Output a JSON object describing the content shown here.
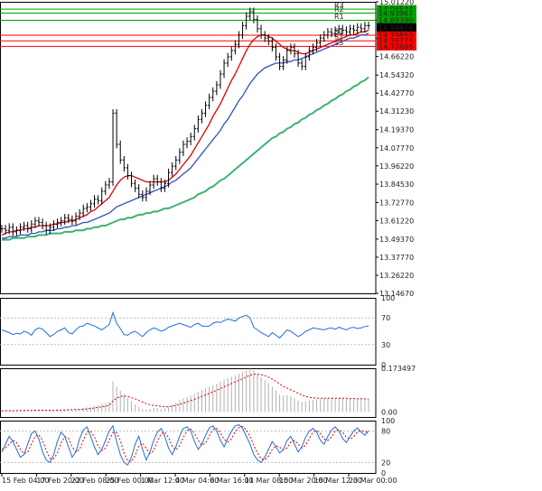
{
  "chart_data": {
    "type": "line",
    "main": {
      "y_axis_ticks": [
        "15.01220",
        "14.89510",
        "14.77700",
        "14.66220",
        "14.54320",
        "14.42770",
        "14.31230",
        "14.19370",
        "14.07770",
        "13.96220",
        "13.84530",
        "13.72770",
        "13.61220",
        "13.49370",
        "13.37770",
        "13.26220",
        "13.14670"
      ],
      "ylim": [
        13.1467,
        15.0122
      ],
      "x_tick_labels": [
        "15 Feb 04:00",
        "17 Feb 20:00",
        "22 Feb 08:00",
        "25 Feb 00:00",
        "1 Mar 12:00",
        "4 Mar 04:00",
        "8 Mar 16:00",
        "11 Mar 08:00",
        "15 Mar 20:00",
        "18 Mar 12:00",
        "23 Mar 00:00"
      ],
      "price_close": [
        13.56,
        13.55,
        13.57,
        13.54,
        13.55,
        13.57,
        13.58,
        13.56,
        13.59,
        13.61,
        13.6,
        13.58,
        13.55,
        13.57,
        13.59,
        13.6,
        13.61,
        13.63,
        13.62,
        13.61,
        13.64,
        13.66,
        13.69,
        13.7,
        13.72,
        13.75,
        13.74,
        13.8,
        13.84,
        13.86,
        14.3,
        14.1,
        14.0,
        13.95,
        13.9,
        13.85,
        13.82,
        13.78,
        13.76,
        13.8,
        13.84,
        13.88,
        13.86,
        13.82,
        13.85,
        13.92,
        13.96,
        14.0,
        14.05,
        14.1,
        14.12,
        14.15,
        14.2,
        14.26,
        14.3,
        14.35,
        14.4,
        14.44,
        14.48,
        14.55,
        14.62,
        14.66,
        14.7,
        14.74,
        14.8,
        14.86,
        14.92,
        14.95,
        14.9,
        14.84,
        14.8,
        14.78,
        14.76,
        14.72,
        14.66,
        14.6,
        14.64,
        14.7,
        14.72,
        14.68,
        14.62,
        14.6,
        14.66,
        14.7,
        14.72,
        14.75,
        14.78,
        14.8,
        14.82,
        14.81,
        14.83,
        14.84,
        14.83,
        14.82,
        14.84,
        14.83,
        14.85,
        14.84,
        14.86,
        14.86
      ],
      "ma_fast_red": [
        13.52,
        13.53,
        13.54,
        13.54,
        13.55,
        13.55,
        13.56,
        13.56,
        13.57,
        13.57,
        13.58,
        13.58,
        13.58,
        13.58,
        13.59,
        13.59,
        13.6,
        13.6,
        13.61,
        13.61,
        13.62,
        13.63,
        13.64,
        13.65,
        13.67,
        13.68,
        13.7,
        13.72,
        13.74,
        13.76,
        13.8,
        13.84,
        13.87,
        13.89,
        13.9,
        13.9,
        13.89,
        13.88,
        13.87,
        13.86,
        13.86,
        13.86,
        13.86,
        13.86,
        13.86,
        13.87,
        13.89,
        13.91,
        13.94,
        13.97,
        14.0,
        14.03,
        14.07,
        14.11,
        14.15,
        14.19,
        14.23,
        14.28,
        14.32,
        14.36,
        14.41,
        14.46,
        14.51,
        14.55,
        14.6,
        14.65,
        14.7,
        14.74,
        14.77,
        14.79,
        14.8,
        14.8,
        14.79,
        14.78,
        14.76,
        14.74,
        14.72,
        14.71,
        14.7,
        14.7,
        14.69,
        14.68,
        14.68,
        14.69,
        14.7,
        14.71,
        14.72,
        14.73,
        14.74,
        14.75,
        14.76,
        14.77,
        14.78,
        14.79,
        14.8,
        14.8,
        14.81,
        14.82,
        14.82,
        14.83
      ],
      "ma_mid_blue": [
        13.5,
        13.5,
        13.51,
        13.51,
        13.51,
        13.52,
        13.52,
        13.52,
        13.53,
        13.53,
        13.54,
        13.54,
        13.55,
        13.55,
        13.55,
        13.56,
        13.56,
        13.57,
        13.57,
        13.58,
        13.58,
        13.59,
        13.6,
        13.6,
        13.61,
        13.62,
        13.63,
        13.64,
        13.65,
        13.66,
        13.68,
        13.7,
        13.71,
        13.72,
        13.73,
        13.74,
        13.75,
        13.76,
        13.77,
        13.78,
        13.79,
        13.8,
        13.81,
        13.82,
        13.83,
        13.84,
        13.86,
        13.87,
        13.89,
        13.91,
        13.93,
        13.95,
        13.98,
        14.01,
        14.04,
        14.07,
        14.1,
        14.13,
        14.16,
        14.19,
        14.23,
        14.26,
        14.3,
        14.34,
        14.38,
        14.41,
        14.45,
        14.49,
        14.52,
        14.55,
        14.57,
        14.59,
        14.6,
        14.61,
        14.62,
        14.62,
        14.62,
        14.63,
        14.63,
        14.64,
        14.64,
        14.65,
        14.66,
        14.67,
        14.68,
        14.69,
        14.7,
        14.71,
        14.72,
        14.73,
        14.74,
        14.75,
        14.76,
        14.77,
        14.78,
        14.78,
        14.79,
        14.8,
        14.8,
        14.81
      ],
      "ma_slow_green": [
        13.49,
        13.49,
        13.49,
        13.5,
        13.5,
        13.5,
        13.5,
        13.51,
        13.51,
        13.51,
        13.52,
        13.52,
        13.52,
        13.53,
        13.53,
        13.53,
        13.53,
        13.54,
        13.54,
        13.54,
        13.55,
        13.55,
        13.55,
        13.56,
        13.56,
        13.57,
        13.57,
        13.58,
        13.58,
        13.59,
        13.6,
        13.61,
        13.62,
        13.62,
        13.63,
        13.63,
        13.64,
        13.65,
        13.65,
        13.66,
        13.66,
        13.67,
        13.67,
        13.68,
        13.69,
        13.69,
        13.7,
        13.71,
        13.72,
        13.73,
        13.74,
        13.75,
        13.76,
        13.78,
        13.79,
        13.8,
        13.82,
        13.83,
        13.85,
        13.87,
        13.88,
        13.9,
        13.92,
        13.94,
        13.96,
        13.98,
        14.0,
        14.02,
        14.04,
        14.06,
        14.08,
        14.1,
        14.12,
        14.14,
        14.15,
        14.17,
        14.18,
        14.2,
        14.21,
        14.23,
        14.24,
        14.26,
        14.27,
        14.29,
        14.3,
        14.32,
        14.33,
        14.35,
        14.36,
        14.38,
        14.39,
        14.41,
        14.42,
        14.44,
        14.45,
        14.47,
        14.48,
        14.5,
        14.51,
        14.53
      ],
      "levels": [
        {
          "label": "R3",
          "value": "14.96544",
          "color": "#00a000"
        },
        {
          "label": "R2",
          "value": "14.93967",
          "color": "#00a000"
        },
        {
          "label": "R1",
          "value": "14.89390",
          "color": "#00a000"
        },
        {
          "label": "S1",
          "value": "14.79850",
          "color": "#ff0000"
        },
        {
          "label": "S2",
          "value": "14.76273",
          "color": "#ff0000"
        },
        {
          "label": "S3",
          "value": "14.72696",
          "color": "#ff0000"
        }
      ],
      "current_price": "14.84870"
    },
    "rsi": {
      "y_ticks": [
        "100",
        "70",
        "30",
        "0"
      ],
      "ylim": [
        0,
        100
      ],
      "values": [
        52,
        50,
        48,
        45,
        47,
        46,
        50,
        48,
        44,
        52,
        55,
        53,
        48,
        42,
        45,
        50,
        52,
        55,
        48,
        46,
        52,
        57,
        58,
        62,
        60,
        58,
        55,
        52,
        56,
        60,
        78,
        62,
        54,
        45,
        44,
        48,
        50,
        46,
        42,
        48,
        52,
        55,
        53,
        50,
        52,
        56,
        58,
        60,
        62,
        60,
        58,
        56,
        60,
        62,
        58,
        57,
        58,
        62,
        64,
        63,
        66,
        68,
        67,
        65,
        70,
        72,
        74,
        70,
        56,
        52,
        48,
        45,
        42,
        48,
        44,
        40,
        46,
        52,
        50,
        46,
        42,
        45,
        50,
        52,
        55,
        54,
        53,
        52,
        54,
        55,
        53,
        56,
        54,
        52,
        55,
        56,
        54,
        55,
        57,
        58
      ]
    },
    "macd": {
      "y_ticks": [
        "0.173497",
        "0.00"
      ],
      "ylim": [
        -0.02,
        0.1735
      ],
      "histogram": [
        0.005,
        0.006,
        0.006,
        0.005,
        0.006,
        0.007,
        0.007,
        0.006,
        0.007,
        0.008,
        0.008,
        0.007,
        0.006,
        0.007,
        0.008,
        0.008,
        0.009,
        0.01,
        0.01,
        0.01,
        0.011,
        0.013,
        0.016,
        0.018,
        0.021,
        0.024,
        0.026,
        0.031,
        0.036,
        0.04,
        0.12,
        0.1,
        0.085,
        0.07,
        0.055,
        0.042,
        0.03,
        0.02,
        0.012,
        0.01,
        0.012,
        0.016,
        0.015,
        0.012,
        0.014,
        0.022,
        0.03,
        0.038,
        0.046,
        0.054,
        0.06,
        0.065,
        0.072,
        0.08,
        0.088,
        0.094,
        0.1,
        0.106,
        0.112,
        0.12,
        0.128,
        0.134,
        0.14,
        0.146,
        0.152,
        0.158,
        0.165,
        0.172,
        0.165,
        0.15,
        0.138,
        0.126,
        0.115,
        0.1,
        0.085,
        0.07,
        0.065,
        0.066,
        0.062,
        0.055,
        0.045,
        0.04,
        0.042,
        0.045,
        0.048,
        0.05,
        0.052,
        0.054,
        0.055,
        0.056,
        0.055,
        0.054,
        0.053,
        0.052,
        0.052,
        0.05,
        0.05,
        0.049,
        0.05,
        0.05
      ],
      "signal": [
        0.004,
        0.005,
        0.005,
        0.005,
        0.005,
        0.006,
        0.006,
        0.006,
        0.006,
        0.007,
        0.007,
        0.007,
        0.007,
        0.007,
        0.007,
        0.007,
        0.008,
        0.008,
        0.009,
        0.009,
        0.01,
        0.01,
        0.011,
        0.012,
        0.014,
        0.016,
        0.018,
        0.02,
        0.023,
        0.026,
        0.044,
        0.055,
        0.061,
        0.063,
        0.061,
        0.057,
        0.052,
        0.046,
        0.039,
        0.033,
        0.029,
        0.026,
        0.024,
        0.022,
        0.021,
        0.021,
        0.023,
        0.026,
        0.03,
        0.035,
        0.04,
        0.045,
        0.05,
        0.056,
        0.062,
        0.068,
        0.074,
        0.08,
        0.086,
        0.093,
        0.1,
        0.106,
        0.113,
        0.119,
        0.126,
        0.132,
        0.139,
        0.146,
        0.15,
        0.15,
        0.148,
        0.144,
        0.138,
        0.131,
        0.122,
        0.111,
        0.102,
        0.095,
        0.088,
        0.081,
        0.074,
        0.067,
        0.062,
        0.058,
        0.056,
        0.055,
        0.054,
        0.054,
        0.054,
        0.054,
        0.054,
        0.054,
        0.054,
        0.054,
        0.053,
        0.053,
        0.052,
        0.052,
        0.052,
        0.051
      ]
    },
    "stoch": {
      "y_ticks": [
        "100",
        "80",
        "20",
        "0"
      ],
      "ylim": [
        0,
        100
      ],
      "k": [
        40,
        55,
        70,
        60,
        45,
        30,
        35,
        55,
        75,
        80,
        65,
        40,
        25,
        20,
        35,
        60,
        78,
        70,
        50,
        30,
        40,
        65,
        82,
        88,
        70,
        50,
        35,
        45,
        62,
        80,
        90,
        60,
        35,
        20,
        15,
        30,
        55,
        70,
        45,
        25,
        40,
        62,
        78,
        85,
        70,
        48,
        35,
        50,
        70,
        85,
        88,
        80,
        60,
        45,
        55,
        72,
        86,
        90,
        80,
        62,
        50,
        66,
        80,
        90,
        92,
        85,
        70,
        55,
        35,
        25,
        20,
        30,
        45,
        60,
        50,
        38,
        45,
        62,
        70,
        55,
        40,
        50,
        68,
        80,
        85,
        78,
        62,
        55,
        70,
        82,
        88,
        80,
        66,
        58,
        70,
        80,
        86,
        78,
        72,
        80
      ],
      "d": [
        45,
        48,
        55,
        62,
        58,
        45,
        37,
        40,
        55,
        70,
        73,
        62,
        43,
        28,
        27,
        38,
        58,
        69,
        66,
        50,
        40,
        45,
        62,
        78,
        80,
        69,
        52,
        43,
        47,
        62,
        77,
        77,
        62,
        38,
        23,
        22,
        33,
        52,
        57,
        47,
        37,
        42,
        60,
        75,
        78,
        68,
        51,
        44,
        52,
        68,
        81,
        84,
        76,
        62,
        53,
        57,
        71,
        83,
        85,
        77,
        64,
        59,
        65,
        79,
        87,
        89,
        82,
        70,
        53,
        38,
        27,
        25,
        32,
        45,
        52,
        49,
        44,
        48,
        59,
        62,
        55,
        48,
        53,
        66,
        78,
        81,
        75,
        65,
        62,
        69,
        80,
        83,
        78,
        68,
        65,
        69,
        79,
        81,
        79,
        77
      ]
    }
  }
}
